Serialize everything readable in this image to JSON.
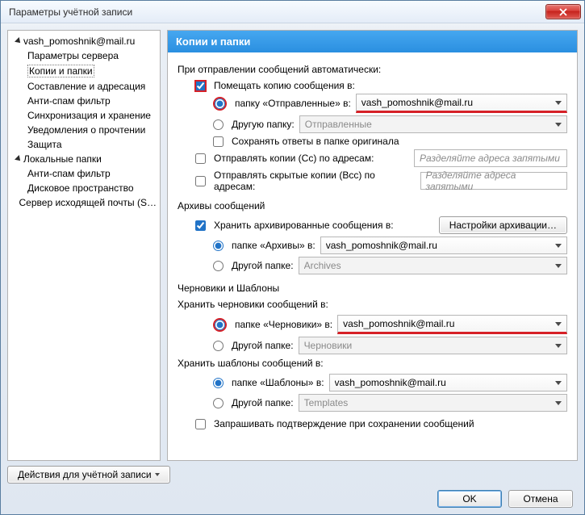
{
  "window": {
    "title": "Параметры учётной записи"
  },
  "tree": {
    "account": "vash_pomoshnik@mail.ru",
    "items": [
      "Параметры сервера",
      "Копии и папки",
      "Составление и адресация",
      "Анти-спам фильтр",
      "Синхронизация и хранение",
      "Уведомления о прочтении",
      "Защита"
    ],
    "local": "Локальные папки",
    "local_items": [
      "Анти-спам фильтр",
      "Дисковое пространство"
    ],
    "smtp": "Сервер исходящей почты (S…"
  },
  "panel": {
    "title": "Копии и папки"
  },
  "send": {
    "heading": "При отправлении сообщений автоматически:",
    "keep_copy": "Помещать копию сообщения в:",
    "sent_folder": "папку «Отправленные» в:",
    "sent_account": "vash_pomoshnik@mail.ru",
    "other_folder": "Другую папку:",
    "other_value": "Отправленные",
    "save_replies": "Сохранять ответы в папке оригинала",
    "cc_label": "Отправлять копии (Cc) по адресам:",
    "bcc_label": "Отправлять скрытые копии (Bcc) по адресам:",
    "sep_placeholder": "Разделяйте адреса запятыми"
  },
  "arch": {
    "heading": "Архивы сообщений",
    "keep": "Хранить архивированные сообщения в:",
    "settings_btn": "Настройки архивации…",
    "folder": "папке «Архивы» в:",
    "account": "vash_pomoshnik@mail.ru",
    "other": "Другой папке:",
    "other_value": "Archives"
  },
  "drafts": {
    "heading": "Черновики и Шаблоны",
    "drafts_label": "Хранить черновики сообщений в:",
    "drafts_folder": "папке «Черновики» в:",
    "drafts_account": "vash_pomoshnik@mail.ru",
    "drafts_other": "Другой папке:",
    "drafts_other_value": "Черновики",
    "templates_label": "Хранить шаблоны сообщений в:",
    "templates_folder": "папке «Шаблоны» в:",
    "templates_account": "vash_pomoshnik@mail.ru",
    "templates_other": "Другой папке:",
    "templates_other_value": "Templates"
  },
  "confirm": "Запрашивать подтверждение при сохранении сообщений",
  "actions_btn": "Действия для учётной записи",
  "footer": {
    "ok": "OK",
    "cancel": "Отмена"
  }
}
